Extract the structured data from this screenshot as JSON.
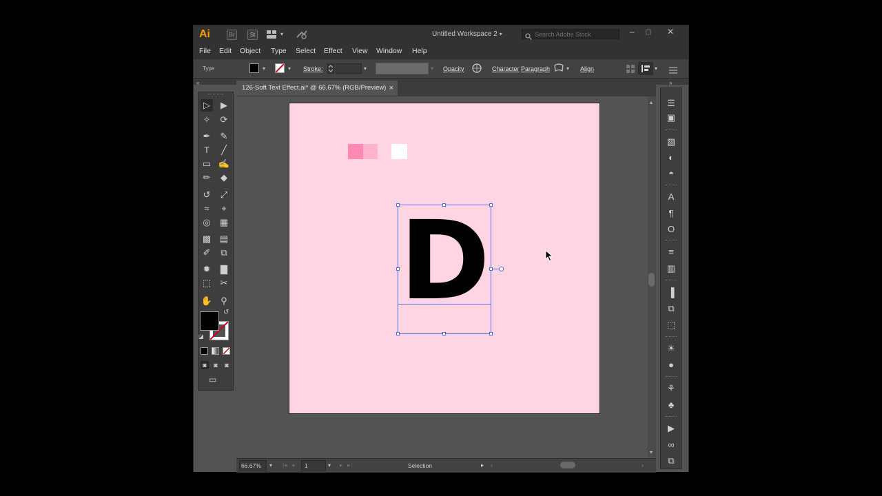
{
  "app": {
    "logo": "Ai",
    "br_badge": "Br",
    "st_badge": "St",
    "workspace": "Untitled Workspace 2",
    "search_placeholder": "Search Adobe Stock"
  },
  "window_controls": {
    "minimize": "–",
    "restore": "□",
    "close": "✕"
  },
  "menu": [
    "File",
    "Edit",
    "Object",
    "Type",
    "Select",
    "Effect",
    "View",
    "Window",
    "Help"
  ],
  "control_bar": {
    "mode_label": "Type",
    "stroke_label": "Stroke:",
    "opacity_label": "Opacity",
    "character_label": "Character",
    "paragraph_label": "Paragraph",
    "align_label": "Align",
    "fill_color": "#000000"
  },
  "document": {
    "tab_title": "126-Soft Text Effect.ai* @ 66.67% (RGB/Preview)",
    "tab_close": "×"
  },
  "artboard": {
    "background": "#ffd4e3",
    "text": "D",
    "text_color": "#000000",
    "swatches": [
      "#ff89b2",
      "#ffb2cc",
      "#ffffff"
    ]
  },
  "toolbox": {
    "tools": [
      {
        "name": "selection-tool",
        "glyph": "▷"
      },
      {
        "name": "direct-selection-tool",
        "glyph": "▶"
      },
      {
        "name": "magic-wand-tool",
        "glyph": "✧"
      },
      {
        "name": "lasso-tool",
        "glyph": "⟳"
      },
      {
        "name": "pen-tool",
        "glyph": "✒"
      },
      {
        "name": "curvature-tool",
        "glyph": "✎"
      },
      {
        "name": "type-tool",
        "glyph": "T"
      },
      {
        "name": "line-tool",
        "glyph": "╱"
      },
      {
        "name": "rectangle-tool",
        "glyph": "▭"
      },
      {
        "name": "paintbrush-tool",
        "glyph": "✍"
      },
      {
        "name": "shaper-tool",
        "glyph": "✏"
      },
      {
        "name": "eraser-tool",
        "glyph": "◆"
      },
      {
        "name": "rotate-tool",
        "glyph": "↺"
      },
      {
        "name": "scale-tool",
        "glyph": "⤢"
      },
      {
        "name": "warp-tool",
        "glyph": "≈"
      },
      {
        "name": "free-transform-tool",
        "glyph": "⌖"
      },
      {
        "name": "shape-builder-tool",
        "glyph": "◎"
      },
      {
        "name": "perspective-grid-tool",
        "glyph": "▦"
      },
      {
        "name": "mesh-tool",
        "glyph": "▩"
      },
      {
        "name": "gradient-tool",
        "glyph": "▤"
      },
      {
        "name": "eyedropper-tool",
        "glyph": "✐"
      },
      {
        "name": "blend-tool",
        "glyph": "⧉"
      },
      {
        "name": "symbol-sprayer-tool",
        "glyph": "✹"
      },
      {
        "name": "column-graph-tool",
        "glyph": "▇"
      },
      {
        "name": "artboard-tool",
        "glyph": "⬚"
      },
      {
        "name": "slice-tool",
        "glyph": "✂"
      },
      {
        "name": "hand-tool",
        "glyph": "✋"
      },
      {
        "name": "zoom-tool",
        "glyph": "⚲"
      }
    ],
    "fill_color": "#000000",
    "stroke_color": "#ffffff"
  },
  "right_panels": [
    {
      "name": "layers-icon",
      "glyph": "☰"
    },
    {
      "name": "libraries-icon",
      "glyph": "▣"
    },
    {
      "name": "transform-icon",
      "glyph": "▧"
    },
    {
      "name": "color-icon",
      "glyph": "◐"
    },
    {
      "name": "color-guide-icon",
      "glyph": "◓"
    },
    {
      "name": "character-icon",
      "glyph": "A"
    },
    {
      "name": "paragraph-icon",
      "glyph": "¶"
    },
    {
      "name": "opentype-icon",
      "glyph": "O"
    },
    {
      "name": "stroke-icon",
      "glyph": "≡"
    },
    {
      "name": "gradient-icon",
      "glyph": "▥"
    },
    {
      "name": "align-icon",
      "glyph": "▐"
    },
    {
      "name": "pathfinder-icon",
      "glyph": "⧉"
    },
    {
      "name": "transform-grid-icon",
      "glyph": "⬚"
    },
    {
      "name": "appearance-icon",
      "glyph": "☀"
    },
    {
      "name": "graphic-styles-icon",
      "glyph": "●"
    },
    {
      "name": "brushes-icon",
      "glyph": "⚘"
    },
    {
      "name": "symbols-icon",
      "glyph": "♣"
    },
    {
      "name": "actions-icon",
      "glyph": "▶"
    },
    {
      "name": "links-icon",
      "glyph": "∞"
    },
    {
      "name": "artboards-icon",
      "glyph": "⧉"
    }
  ],
  "status_bar": {
    "zoom": "66.67%",
    "artboard_number": "1",
    "tool_name": "Selection"
  }
}
